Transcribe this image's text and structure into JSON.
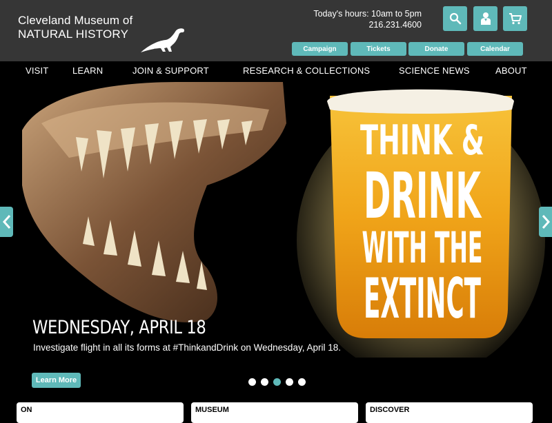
{
  "logo": {
    "line1": "Cleveland Museum of",
    "line2": "NATURAL HISTORY"
  },
  "hours": {
    "text": "Today's hours: 10am to 5pm",
    "phone": "216.231.4600"
  },
  "icons": {
    "search": "search-icon",
    "member": "member-icon",
    "cart": "cart-icon"
  },
  "quick_links": [
    "Campaign",
    "Tickets",
    "Donate",
    "Calendar"
  ],
  "nav": [
    "VISIT",
    "LEARN",
    "JOIN & SUPPORT",
    "RESEARCH & COLLECTIONS",
    "SCIENCE NEWS",
    "ABOUT"
  ],
  "hero": {
    "glass_text": [
      "THINK &",
      "DRINK",
      "WITH THE",
      "EXTINCT"
    ],
    "title": "WEDNESDAY, APRIL 18",
    "description": "Investigate flight in all its forms at #ThinkandDrink on Wednesday, April 18.",
    "button": "Learn More",
    "slide_count": 5,
    "active_slide": 3
  },
  "cards": [
    "ON",
    "MUSEUM",
    "DISCOVER"
  ],
  "colors": {
    "accent": "#5fb9b9",
    "header_bg": "#363636"
  }
}
